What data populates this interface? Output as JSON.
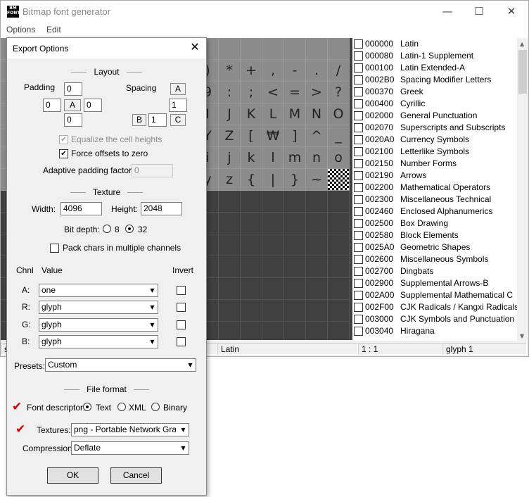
{
  "window": {
    "title": "Bitmap font generator",
    "icon_text": "BM FONT",
    "minimize": "—",
    "maximize": "☐",
    "close": "✕"
  },
  "menu": {
    "options": "Options",
    "edit": "Edit"
  },
  "glyph_grid": {
    "rows": [
      [
        ")",
        "*",
        "+",
        ",",
        "-",
        ".",
        "/"
      ],
      [
        "9",
        ":",
        ";",
        "<",
        "=",
        ">",
        "?"
      ],
      [
        "I",
        "J",
        "K",
        "L",
        "M",
        "N",
        "O"
      ],
      [
        "Y",
        "Z",
        "[",
        "₩",
        "]",
        "^",
        "_"
      ],
      [
        "i",
        "j",
        "k",
        "l",
        "m",
        "n",
        "o"
      ],
      [
        "y",
        "z",
        "{",
        "|",
        "}",
        "~",
        ""
      ]
    ]
  },
  "char_sets": [
    {
      "code": "000000",
      "name": "Latin"
    },
    {
      "code": "000080",
      "name": "Latin-1 Supplement"
    },
    {
      "code": "000100",
      "name": "Latin Extended-A"
    },
    {
      "code": "0002B0",
      "name": "Spacing Modifier Letters"
    },
    {
      "code": "000370",
      "name": "Greek"
    },
    {
      "code": "000400",
      "name": "Cyrillic"
    },
    {
      "code": "002000",
      "name": "General Punctuation"
    },
    {
      "code": "002070",
      "name": "Superscripts and Subscripts"
    },
    {
      "code": "0020A0",
      "name": "Currency Symbols"
    },
    {
      "code": "002100",
      "name": "Letterlike Symbols"
    },
    {
      "code": "002150",
      "name": "Number Forms"
    },
    {
      "code": "002190",
      "name": "Arrows"
    },
    {
      "code": "002200",
      "name": "Mathematical Operators"
    },
    {
      "code": "002300",
      "name": "Miscellaneous Technical"
    },
    {
      "code": "002460",
      "name": "Enclosed Alphanumerics"
    },
    {
      "code": "002500",
      "name": "Box Drawing"
    },
    {
      "code": "002580",
      "name": "Block Elements"
    },
    {
      "code": "0025A0",
      "name": "Geometric Shapes"
    },
    {
      "code": "002600",
      "name": "Miscellaneous Symbols"
    },
    {
      "code": "002700",
      "name": "Dingbats"
    },
    {
      "code": "002900",
      "name": "Supplemental Arrows-B"
    },
    {
      "code": "002A00",
      "name": "Supplemental Mathematical C"
    },
    {
      "code": "002F00",
      "name": "CJK Radicals / Kangxi Radicals"
    },
    {
      "code": "003000",
      "name": "CJK Symbols and Punctuation"
    },
    {
      "code": "003040",
      "name": "Hiragana"
    }
  ],
  "status": {
    "left": "s",
    "charset": "Latin",
    "zoom": "1 : 1",
    "glyph": "glyph 1"
  },
  "dialog": {
    "title": "Export Options",
    "close": "✕",
    "layout": {
      "heading": "Layout",
      "padding_label": "Padding",
      "padding_top": "0",
      "padding_left": "0",
      "padding_right": "0",
      "padding_bottom": "0",
      "padding_tag": "A",
      "spacing_label": "Spacing",
      "spacing_tag_a": "A",
      "spacing_horiz": "1",
      "spacing_tag_b": "B",
      "spacing_vert": "1",
      "spacing_tag_c": "C",
      "equalize_label": "Equalize the cell heights",
      "force_offsets_label": "Force offsets to zero",
      "adaptive_label": "Adaptive padding factor:",
      "adaptive_value": "0"
    },
    "texture": {
      "heading": "Texture",
      "width_label": "Width:",
      "width_value": "4096",
      "height_label": "Height:",
      "height_value": "2048",
      "bitdepth_label": "Bit depth:",
      "bitdepth_8": "8",
      "bitdepth_32": "32",
      "pack_label": "Pack chars in multiple channels"
    },
    "channels": {
      "chnl_header": "Chnl",
      "value_header": "Value",
      "invert_header": "Invert",
      "rows": [
        {
          "name": "A:",
          "value": "one"
        },
        {
          "name": "R:",
          "value": "glyph"
        },
        {
          "name": "G:",
          "value": "glyph"
        },
        {
          "name": "B:",
          "value": "glyph"
        }
      ]
    },
    "presets_label": "Presets:",
    "presets_value": "Custom",
    "file_format": {
      "heading": "File format",
      "font_descriptor_label": "Font descriptor:",
      "opt_text": "Text",
      "opt_xml": "XML",
      "opt_binary": "Binary",
      "textures_label": "Textures:",
      "textures_value": "png - Portable Network Graphics",
      "compression_label": "Compression:",
      "compression_value": "Deflate"
    },
    "ok": "OK",
    "cancel": "Cancel"
  },
  "colors": {
    "annotation_red": "#d10000"
  }
}
